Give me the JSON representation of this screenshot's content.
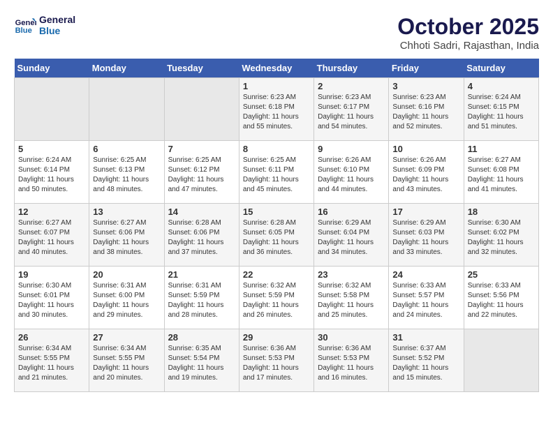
{
  "header": {
    "logo_line1": "General",
    "logo_line2": "Blue",
    "month": "October 2025",
    "location": "Chhoti Sadri, Rajasthan, India"
  },
  "weekdays": [
    "Sunday",
    "Monday",
    "Tuesday",
    "Wednesday",
    "Thursday",
    "Friday",
    "Saturday"
  ],
  "weeks": [
    [
      {
        "day": "",
        "info": ""
      },
      {
        "day": "",
        "info": ""
      },
      {
        "day": "",
        "info": ""
      },
      {
        "day": "1",
        "info": "Sunrise: 6:23 AM\nSunset: 6:18 PM\nDaylight: 11 hours\nand 55 minutes."
      },
      {
        "day": "2",
        "info": "Sunrise: 6:23 AM\nSunset: 6:17 PM\nDaylight: 11 hours\nand 54 minutes."
      },
      {
        "day": "3",
        "info": "Sunrise: 6:23 AM\nSunset: 6:16 PM\nDaylight: 11 hours\nand 52 minutes."
      },
      {
        "day": "4",
        "info": "Sunrise: 6:24 AM\nSunset: 6:15 PM\nDaylight: 11 hours\nand 51 minutes."
      }
    ],
    [
      {
        "day": "5",
        "info": "Sunrise: 6:24 AM\nSunset: 6:14 PM\nDaylight: 11 hours\nand 50 minutes."
      },
      {
        "day": "6",
        "info": "Sunrise: 6:25 AM\nSunset: 6:13 PM\nDaylight: 11 hours\nand 48 minutes."
      },
      {
        "day": "7",
        "info": "Sunrise: 6:25 AM\nSunset: 6:12 PM\nDaylight: 11 hours\nand 47 minutes."
      },
      {
        "day": "8",
        "info": "Sunrise: 6:25 AM\nSunset: 6:11 PM\nDaylight: 11 hours\nand 45 minutes."
      },
      {
        "day": "9",
        "info": "Sunrise: 6:26 AM\nSunset: 6:10 PM\nDaylight: 11 hours\nand 44 minutes."
      },
      {
        "day": "10",
        "info": "Sunrise: 6:26 AM\nSunset: 6:09 PM\nDaylight: 11 hours\nand 43 minutes."
      },
      {
        "day": "11",
        "info": "Sunrise: 6:27 AM\nSunset: 6:08 PM\nDaylight: 11 hours\nand 41 minutes."
      }
    ],
    [
      {
        "day": "12",
        "info": "Sunrise: 6:27 AM\nSunset: 6:07 PM\nDaylight: 11 hours\nand 40 minutes."
      },
      {
        "day": "13",
        "info": "Sunrise: 6:27 AM\nSunset: 6:06 PM\nDaylight: 11 hours\nand 38 minutes."
      },
      {
        "day": "14",
        "info": "Sunrise: 6:28 AM\nSunset: 6:06 PM\nDaylight: 11 hours\nand 37 minutes."
      },
      {
        "day": "15",
        "info": "Sunrise: 6:28 AM\nSunset: 6:05 PM\nDaylight: 11 hours\nand 36 minutes."
      },
      {
        "day": "16",
        "info": "Sunrise: 6:29 AM\nSunset: 6:04 PM\nDaylight: 11 hours\nand 34 minutes."
      },
      {
        "day": "17",
        "info": "Sunrise: 6:29 AM\nSunset: 6:03 PM\nDaylight: 11 hours\nand 33 minutes."
      },
      {
        "day": "18",
        "info": "Sunrise: 6:30 AM\nSunset: 6:02 PM\nDaylight: 11 hours\nand 32 minutes."
      }
    ],
    [
      {
        "day": "19",
        "info": "Sunrise: 6:30 AM\nSunset: 6:01 PM\nDaylight: 11 hours\nand 30 minutes."
      },
      {
        "day": "20",
        "info": "Sunrise: 6:31 AM\nSunset: 6:00 PM\nDaylight: 11 hours\nand 29 minutes."
      },
      {
        "day": "21",
        "info": "Sunrise: 6:31 AM\nSunset: 5:59 PM\nDaylight: 11 hours\nand 28 minutes."
      },
      {
        "day": "22",
        "info": "Sunrise: 6:32 AM\nSunset: 5:59 PM\nDaylight: 11 hours\nand 26 minutes."
      },
      {
        "day": "23",
        "info": "Sunrise: 6:32 AM\nSunset: 5:58 PM\nDaylight: 11 hours\nand 25 minutes."
      },
      {
        "day": "24",
        "info": "Sunrise: 6:33 AM\nSunset: 5:57 PM\nDaylight: 11 hours\nand 24 minutes."
      },
      {
        "day": "25",
        "info": "Sunrise: 6:33 AM\nSunset: 5:56 PM\nDaylight: 11 hours\nand 22 minutes."
      }
    ],
    [
      {
        "day": "26",
        "info": "Sunrise: 6:34 AM\nSunset: 5:55 PM\nDaylight: 11 hours\nand 21 minutes."
      },
      {
        "day": "27",
        "info": "Sunrise: 6:34 AM\nSunset: 5:55 PM\nDaylight: 11 hours\nand 20 minutes."
      },
      {
        "day": "28",
        "info": "Sunrise: 6:35 AM\nSunset: 5:54 PM\nDaylight: 11 hours\nand 19 minutes."
      },
      {
        "day": "29",
        "info": "Sunrise: 6:36 AM\nSunset: 5:53 PM\nDaylight: 11 hours\nand 17 minutes."
      },
      {
        "day": "30",
        "info": "Sunrise: 6:36 AM\nSunset: 5:53 PM\nDaylight: 11 hours\nand 16 minutes."
      },
      {
        "day": "31",
        "info": "Sunrise: 6:37 AM\nSunset: 5:52 PM\nDaylight: 11 hours\nand 15 minutes."
      },
      {
        "day": "",
        "info": ""
      }
    ]
  ]
}
